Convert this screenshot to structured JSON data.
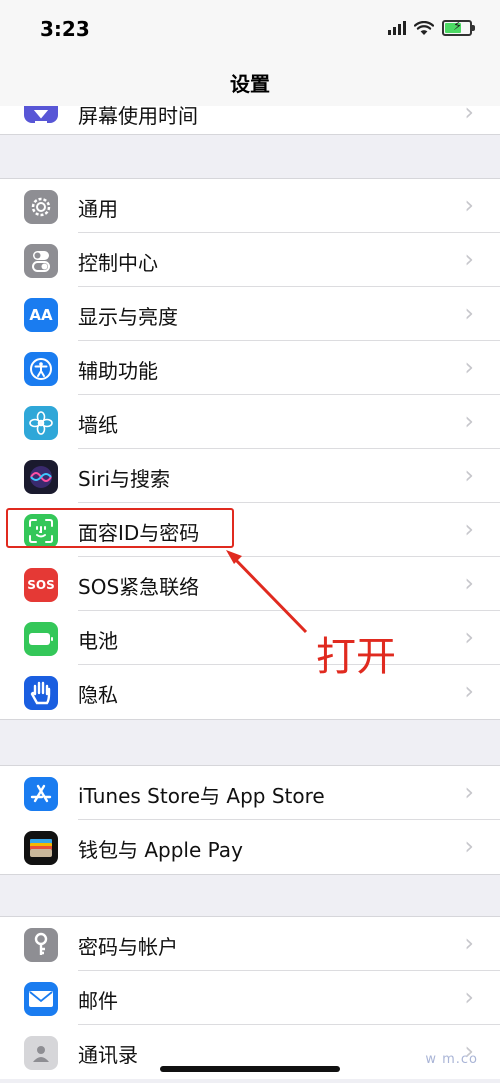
{
  "status": {
    "time": "3:23"
  },
  "nav": {
    "title": "设置"
  },
  "partial_row": {
    "label": "屏幕使用时间",
    "icon": "hourglass-icon"
  },
  "group1": [
    {
      "label": "通用",
      "icon": "gear-icon",
      "color": "#8e8e93"
    },
    {
      "label": "控制中心",
      "icon": "toggles-icon",
      "color": "#8e8e93"
    },
    {
      "label": "显示与亮度",
      "icon": "AA",
      "color": "#1a7cf0"
    },
    {
      "label": "辅助功能",
      "icon": "accessibility-icon",
      "color": "#1a7cf0"
    },
    {
      "label": "墙纸",
      "icon": "flower-icon",
      "color": "#2fa7d8"
    },
    {
      "label": "Siri与搜索",
      "icon": "siri-icon",
      "color": "#1a1a2e"
    },
    {
      "label": "面容ID与密码",
      "icon": "face-id-icon",
      "color": "#34c759"
    },
    {
      "label": "SOS紧急联络",
      "icon": "SOS",
      "color": "#e53935"
    },
    {
      "label": "电池",
      "icon": "battery-icon",
      "color": "#34c759"
    },
    {
      "label": "隐私",
      "icon": "hand-icon",
      "color": "#1a5ee0"
    }
  ],
  "group2": [
    {
      "label": "iTunes Store与 App Store",
      "icon": "app-store-icon",
      "color": "#1a7cf0"
    },
    {
      "label": "钱包与 Apple Pay",
      "icon": "wallet-icon",
      "color": "#111111"
    }
  ],
  "group3": [
    {
      "label": "密码与帐户",
      "icon": "key-icon",
      "color": "#8e8e93"
    },
    {
      "label": "邮件",
      "icon": "mail-icon",
      "color": "#1a7cf0"
    },
    {
      "label": "通讯录",
      "icon": "contacts-icon",
      "color": "#b9b9bd"
    }
  ],
  "annotation": {
    "text": "打开",
    "color": "#e02a1f"
  },
  "watermark": "w       m.co"
}
